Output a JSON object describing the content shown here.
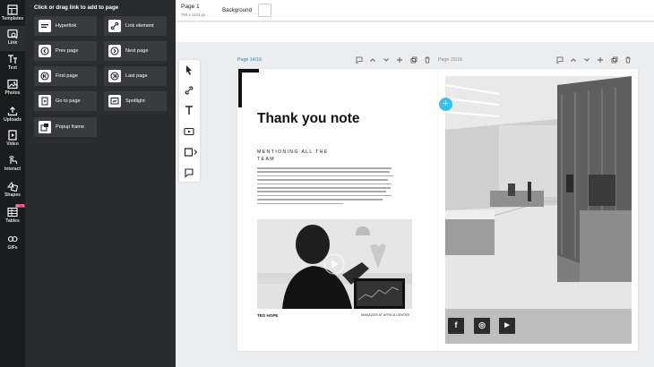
{
  "rail": [
    {
      "label": "Templates",
      "icon": "templates-icon",
      "active": false
    },
    {
      "label": "Link",
      "icon": "link-icon",
      "active": true
    },
    {
      "label": "Text",
      "icon": "text-icon",
      "active": false
    },
    {
      "label": "Photos",
      "icon": "photos-icon",
      "active": false
    },
    {
      "label": "Uploads",
      "icon": "upload-icon",
      "active": false
    },
    {
      "label": "Video",
      "icon": "video-icon",
      "active": false
    },
    {
      "label": "Interact",
      "icon": "interact-icon",
      "active": false
    },
    {
      "label": "Shapes",
      "icon": "shapes-icon",
      "active": false
    },
    {
      "label": "Tables",
      "icon": "tables-icon",
      "active": false,
      "badge": "BETA"
    },
    {
      "label": "GIFs",
      "icon": "gifs-icon",
      "active": false
    }
  ],
  "panel": {
    "title": "Click or drag link to add to page",
    "buttons": [
      {
        "label": "Hyperlink",
        "icon": "hyperlink-icon"
      },
      {
        "label": "Link element",
        "icon": "link-element-icon"
      },
      {
        "label": "Prev page",
        "icon": "prev-page-icon"
      },
      {
        "label": "Next page",
        "icon": "next-page-icon"
      },
      {
        "label": "First page",
        "icon": "first-page-icon"
      },
      {
        "label": "Last page",
        "icon": "last-page-icon"
      },
      {
        "label": "Go to page",
        "icon": "go-to-page-icon"
      },
      {
        "label": "Spotlight",
        "icon": "spotlight-icon"
      },
      {
        "label": "Popup frame",
        "icon": "popup-frame-icon"
      }
    ]
  },
  "topbar": {
    "page_name": "Page 1",
    "page_size": "794 x 1123 px",
    "background_label": "Background",
    "background_color": "#ffffff"
  },
  "tools": [
    "select-icon",
    "link-tool-icon",
    "text-tool-icon",
    "video-tool-icon",
    "shape-tool-icon",
    "comment-tool-icon"
  ],
  "page_left": {
    "label": "Page 14/16",
    "headline": "Thank you note",
    "subhead": "MENTIONING ALL THE TEAM",
    "name": "TED HOPE",
    "role": "MANAGER AT AFRICA CENTER"
  },
  "page_right": {
    "label": "Page 15/16",
    "social": [
      {
        "glyph": "f",
        "icon": "facebook-icon"
      },
      {
        "glyph": "◎",
        "icon": "instagram-icon"
      },
      {
        "glyph": "▶",
        "icon": "youtube-icon"
      }
    ]
  },
  "colors": {
    "accent": "#39c2e8",
    "active_label": "#1a8fd6",
    "rail_bg": "#1b1c1e",
    "panel_bg": "#2a2b2e"
  }
}
